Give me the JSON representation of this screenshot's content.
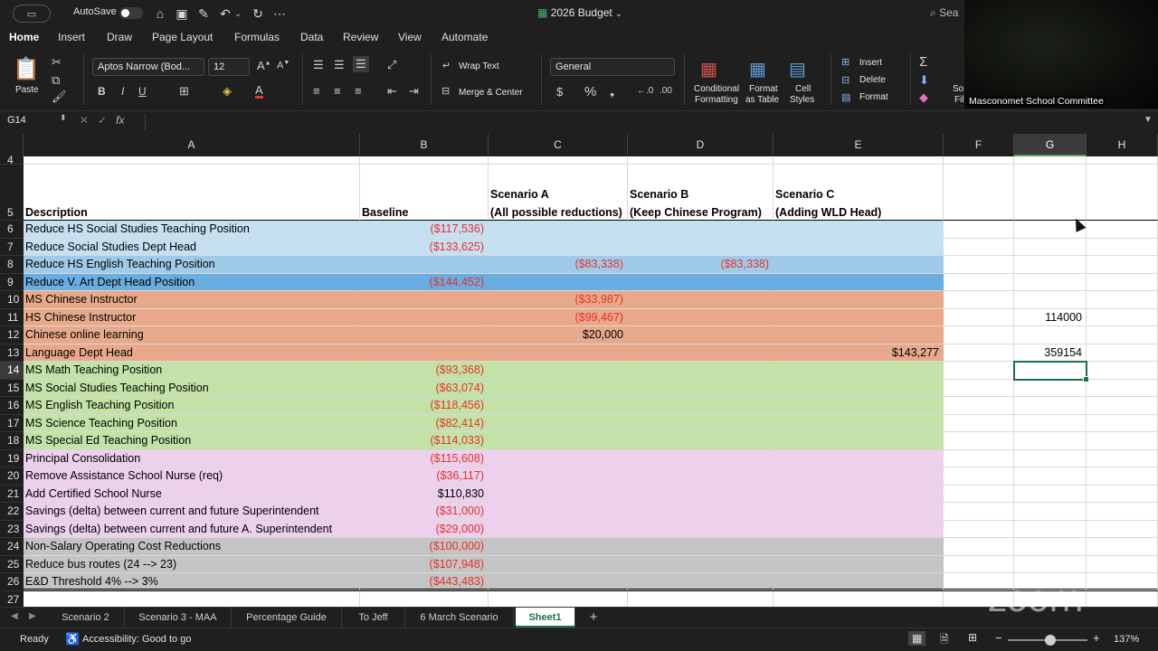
{
  "titlebar": {
    "autosave_label": "AutoSave",
    "doc_title": "2026 Budget",
    "search_placeholder": "Sea"
  },
  "ribbon_tabs": [
    "Home",
    "Insert",
    "Draw",
    "Page Layout",
    "Formulas",
    "Data",
    "Review",
    "View",
    "Automate"
  ],
  "ribbon": {
    "paste": "Paste",
    "font_name": "Aptos Narrow (Bod...",
    "font_size": "12",
    "wrap_text": "Wrap Text",
    "merge_center": "Merge & Center",
    "number_format": "General",
    "conditional_formatting_1": "Conditional",
    "conditional_formatting_2": "Formatting",
    "format_as_table_1": "Format",
    "format_as_table_2": "as Table",
    "cell_styles_1": "Cell",
    "cell_styles_2": "Styles",
    "insert": "Insert",
    "delete": "Delete",
    "format": "Format",
    "sort_1": "So",
    "sort_2": "Fil"
  },
  "formula_bar": {
    "name_box": "G14",
    "fx": "fx",
    "formula": ""
  },
  "columns": [
    "A",
    "B",
    "C",
    "D",
    "E",
    "F",
    "G",
    "H"
  ],
  "selected_column": "G",
  "rows": [
    {
      "num": "4",
      "fill": "#ffffff",
      "A": "",
      "B": "",
      "C": "",
      "D": "",
      "E": "",
      "G": ""
    },
    {
      "num": "5",
      "fill": "#ffffff",
      "header": true,
      "A": "Description",
      "B": "Baseline",
      "C1": "Scenario A",
      "C2": "(All possible reductions)",
      "D1": "Scenario B",
      "D2": "(Keep Chinese Program)",
      "E1": "Scenario C",
      "E2": "(Adding WLD Head)"
    },
    {
      "num": "6",
      "fill": "#c5e0f2",
      "A": "Reduce HS Social Studies Teaching Position",
      "B": "($117,536)",
      "C": "",
      "D": "",
      "E": "",
      "G": ""
    },
    {
      "num": "7",
      "fill": "#c5e0f2",
      "A": "Reduce Social Studies Dept Head",
      "B": "($133,625)",
      "C": "",
      "D": "",
      "E": "",
      "G": ""
    },
    {
      "num": "8",
      "fill": "#9fcbe9",
      "A": "Reduce HS English Teaching Position",
      "B": "",
      "C": "($83,338)",
      "D": "($83,338)",
      "E": "",
      "G": ""
    },
    {
      "num": "9",
      "fill": "#6aade0",
      "A": "Reduce V. Art Dept Head Position",
      "B": "($144,452)",
      "C": "",
      "D": "",
      "E": "",
      "G": ""
    },
    {
      "num": "10",
      "fill": "#e8a98a",
      "A": "MS Chinese Instructor",
      "B": "",
      "C": "($33,987)",
      "D": "",
      "E": "",
      "G": ""
    },
    {
      "num": "11",
      "fill": "#e8a98a",
      "A": "HS Chinese Instructor",
      "B": "",
      "C": "($99,467)",
      "D": "",
      "E": "",
      "G": "114000"
    },
    {
      "num": "12",
      "fill": "#e8a98a",
      "A": "Chinese online learning",
      "B": "",
      "C": "$20,000",
      "D": "",
      "E": "",
      "G": ""
    },
    {
      "num": "13",
      "fill": "#e8a98a",
      "A": "Language Dept Head",
      "B": "",
      "C": "",
      "D": "",
      "E": "$143,277",
      "G": "359154"
    },
    {
      "num": "14",
      "fill": "#c3e2a8",
      "A": "MS Math Teaching Position",
      "B": "($93,368)",
      "C": "",
      "D": "",
      "E": "",
      "G": ""
    },
    {
      "num": "15",
      "fill": "#c3e2a8",
      "A": "MS Social Studies Teaching Position",
      "B": "($63,074)",
      "C": "",
      "D": "",
      "E": "",
      "G": ""
    },
    {
      "num": "16",
      "fill": "#c3e2a8",
      "A": "MS English Teaching Position",
      "B": "($118,456)",
      "C": "",
      "D": "",
      "E": "",
      "G": ""
    },
    {
      "num": "17",
      "fill": "#c3e2a8",
      "A": "MS Science Teaching Position",
      "B": "($82,414)",
      "C": "",
      "D": "",
      "E": "",
      "G": ""
    },
    {
      "num": "18",
      "fill": "#c3e2a8",
      "A": "MS Special Ed Teaching Position",
      "B": "($114,033)",
      "C": "",
      "D": "",
      "E": "",
      "G": ""
    },
    {
      "num": "19",
      "fill": "#ecd0ec",
      "A": "Principal Consolidation",
      "B": "($115,608)",
      "C": "",
      "D": "",
      "E": "",
      "G": ""
    },
    {
      "num": "20",
      "fill": "#ecd0ec",
      "A": "Remove Assistance School Nurse (req)",
      "B": "($36,117)",
      "C": "",
      "D": "",
      "E": "",
      "G": ""
    },
    {
      "num": "21",
      "fill": "#ecd0ec",
      "A": "Add Certified School Nurse",
      "B": "$110,830",
      "C": "",
      "D": "",
      "E": "",
      "G": ""
    },
    {
      "num": "22",
      "fill": "#ecd0ec",
      "A": "Savings (delta) between current and future Superintendent",
      "B": "($31,000)",
      "C": "",
      "D": "",
      "E": "",
      "G": ""
    },
    {
      "num": "23",
      "fill": "#ecd0ec",
      "A": "Savings (delta) between current and future A. Superintendent",
      "B": "($29,000)",
      "C": "",
      "D": "",
      "E": "",
      "G": ""
    },
    {
      "num": "24",
      "fill": "#c4c4c4",
      "A": "Non-Salary Operating Cost Reductions",
      "B": "($100,000)",
      "C": "",
      "D": "",
      "E": "",
      "G": ""
    },
    {
      "num": "25",
      "fill": "#c4c4c4",
      "A": "Reduce bus routes (24 --> 23)",
      "B": "($107,948)",
      "C": "",
      "D": "",
      "E": "",
      "G": ""
    },
    {
      "num": "26",
      "fill": "#c4c4c4",
      "A": "E&D Threshold 4% --> 3%",
      "B": "($443,483)",
      "C": "",
      "D": "",
      "E": "",
      "G": ""
    },
    {
      "num": "27",
      "fill": "#ffffff",
      "A": "",
      "B": "",
      "C": "",
      "D": "",
      "E": "",
      "G": ""
    }
  ],
  "selected_cell": "G14",
  "sheet_tabs": [
    "Scenario 2",
    "Scenario 3 - MAA",
    "Percentage Guide",
    "To Jeff",
    "6 March Scenario",
    "Sheet1"
  ],
  "active_sheet": "Sheet1",
  "add_sheet": "+",
  "status": {
    "ready": "Ready",
    "accessibility": "Accessibility: Good to go",
    "zoom_minus": "−",
    "zoom_plus": "+",
    "zoom_level": "137%"
  },
  "overlay": {
    "participant_name": "Masconomet School Committee",
    "watermark": "zoom"
  },
  "colors": {
    "accent": "#4cc2ff",
    "excel_green": "#1e7145",
    "negative_red": "#e8312a"
  }
}
